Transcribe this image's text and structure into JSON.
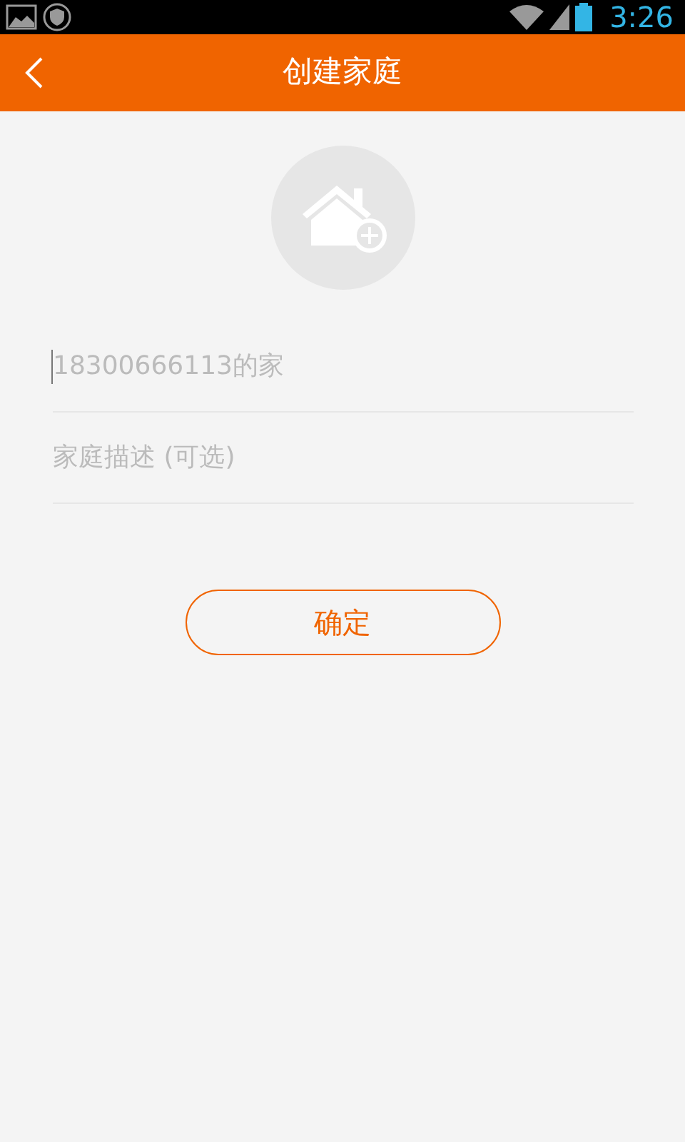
{
  "status_bar": {
    "time": "3:26"
  },
  "header": {
    "title": "创建家庭"
  },
  "fields": [
    {
      "placeholder": "18300666113的家",
      "focused": true
    },
    {
      "placeholder": "家庭描述 (可选)",
      "focused": false
    }
  ],
  "confirm_button": {
    "label": "确定"
  }
}
